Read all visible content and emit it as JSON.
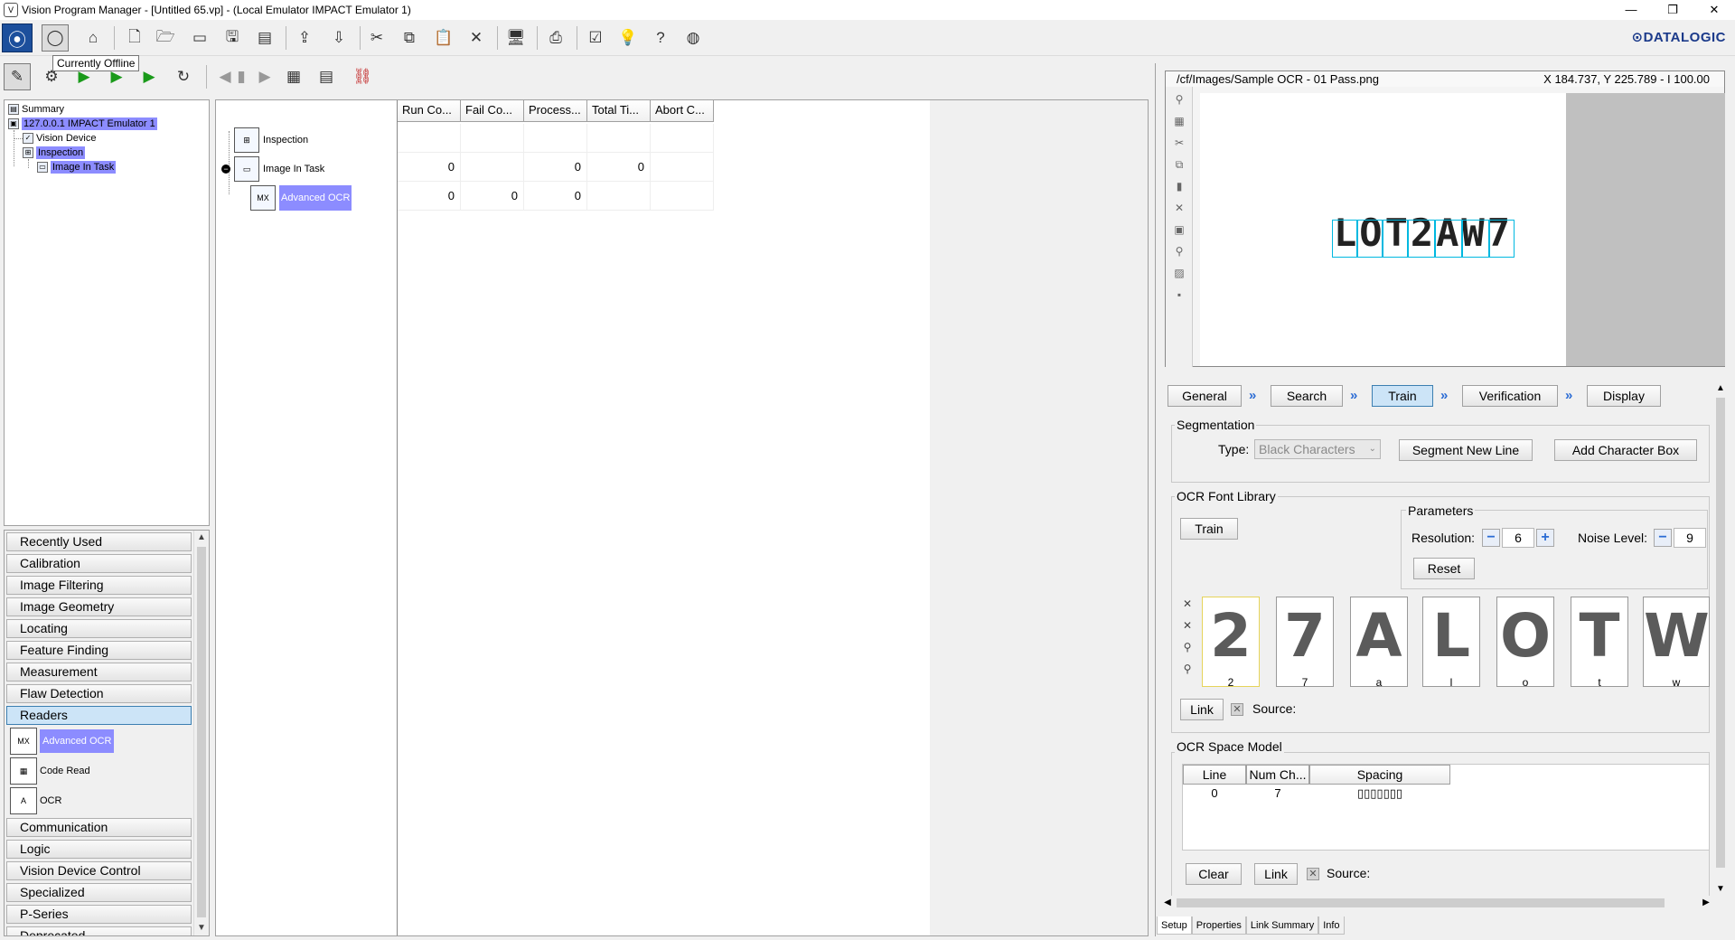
{
  "window": {
    "title": "Vision Program Manager - [Untitled 65.vp] - (Local Emulator IMPACT Emulator 1)",
    "minimize": "—",
    "restore": "❐",
    "close": "✕"
  },
  "toolbar": {
    "tooltip": "Currently Offline",
    "brand": "⊙DATALOGIC"
  },
  "tree": {
    "items": [
      {
        "label": "Summary"
      },
      {
        "label": "127.0.0.1 IMPACT Emulator 1"
      },
      {
        "label": "Vision Device"
      },
      {
        "label": "Inspection"
      },
      {
        "label": "Image In Task"
      }
    ]
  },
  "categories": {
    "items": [
      "Recently Used",
      "Calibration",
      "Image Filtering",
      "Image Geometry",
      "Locating",
      "Feature Finding",
      "Measurement",
      "Flaw Detection",
      "Readers",
      "Communication",
      "Logic",
      "Vision Device Control",
      "Specialized",
      "P-Series",
      "Deprecated"
    ],
    "readers_tools": [
      "Advanced OCR",
      "Code Read",
      "OCR"
    ]
  },
  "grid": {
    "columns": [
      "Run Co...",
      "Fail Co...",
      "Process...",
      "Total Ti...",
      "Abort C..."
    ],
    "rows": [
      {
        "name": "Inspection",
        "values": [
          "",
          "",
          "",
          "",
          ""
        ]
      },
      {
        "name": "Image In Task",
        "values": [
          "0",
          "",
          "0",
          "0",
          ""
        ]
      },
      {
        "name": "Advanced OCR",
        "values": [
          "0",
          "0",
          "0",
          "",
          ""
        ]
      }
    ]
  },
  "image_view": {
    "path": "/cf/Images/Sample OCR - 01 Pass.png",
    "coords": "X 184.737,  Y 225.789  -  I 100.00",
    "ocr_string": "LOT2AW7",
    "char_labels": [
      "l",
      "o",
      "t",
      "2",
      "a",
      "w",
      "7"
    ]
  },
  "wizard_tabs": [
    "General",
    "Search",
    "Train",
    "Verification",
    "Display"
  ],
  "segmentation": {
    "title": "Segmentation",
    "type_label": "Type:",
    "type_value": "Black Characters",
    "segment_button": "Segment New Line",
    "add_box_button": "Add Character Box"
  },
  "font_library": {
    "title": "OCR Font Library",
    "train_button": "Train",
    "parameters_title": "Parameters",
    "resolution_label": "Resolution:",
    "resolution_value": "6",
    "noise_label": "Noise Level:",
    "noise_value": "9",
    "reset_button": "Reset",
    "chars": [
      {
        "glyph": "2",
        "label": "2"
      },
      {
        "glyph": "7",
        "label": "7"
      },
      {
        "glyph": "A",
        "label": "a"
      },
      {
        "glyph": "L",
        "label": "l"
      },
      {
        "glyph": "O",
        "label": "o"
      },
      {
        "glyph": "T",
        "label": "t"
      },
      {
        "glyph": "W",
        "label": "w"
      }
    ],
    "link_button": "Link",
    "source_label": "Source:"
  },
  "space_model": {
    "title": "OCR Space Model",
    "headers": [
      "Line",
      "Num Ch...",
      "Spacing"
    ],
    "row": [
      "0",
      "7",
      "▯▯▯▯▯▯▯"
    ],
    "clear_button": "Clear",
    "link_button": "Link",
    "source_label": "Source:"
  },
  "bottom_tabs": [
    "Setup",
    "Properties",
    "Link Summary",
    "Info"
  ],
  "colors": {
    "selection": "#8c8cff",
    "active_tab": "#cce4f7",
    "ocr_box": "#00b8e0"
  }
}
